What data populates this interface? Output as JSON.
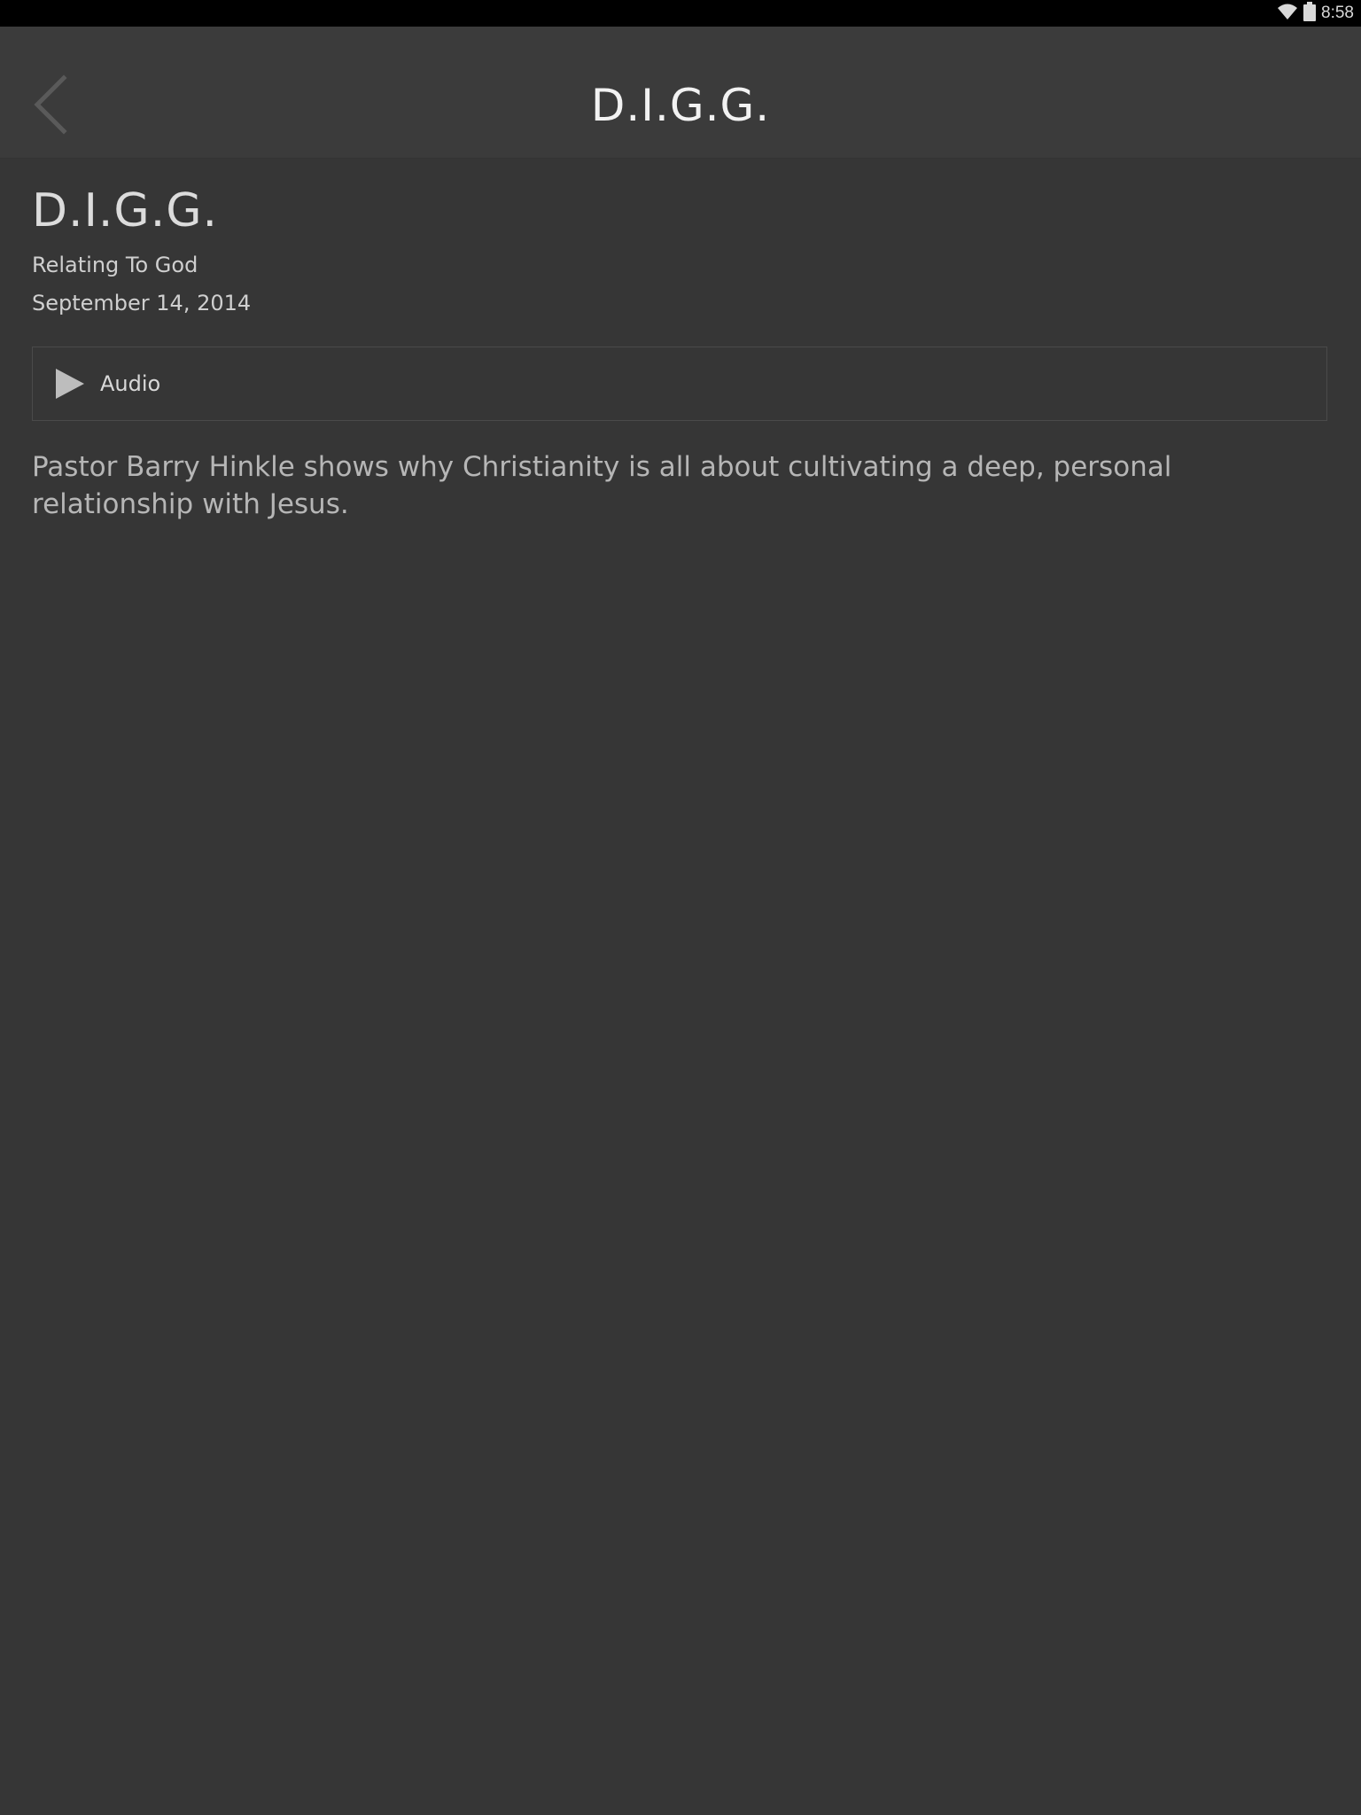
{
  "status_bar": {
    "time": "8:58",
    "icons": [
      "wifi-icon",
      "battery-icon"
    ]
  },
  "header": {
    "title": "D.I.G.G.",
    "back_icon": "chevron-left-icon"
  },
  "item": {
    "title": "D.I.G.G.",
    "subtitle": "Relating To God",
    "date": "September 14, 2014"
  },
  "media": {
    "label": "Audio",
    "icon": "play-icon"
  },
  "description": "Pastor Barry Hinkle shows why Christianity is all about cultivating a deep, personal relationship with Jesus.",
  "colors": {
    "background": "#363636",
    "header": "#3b3b3b",
    "status_bar": "#000000"
  }
}
